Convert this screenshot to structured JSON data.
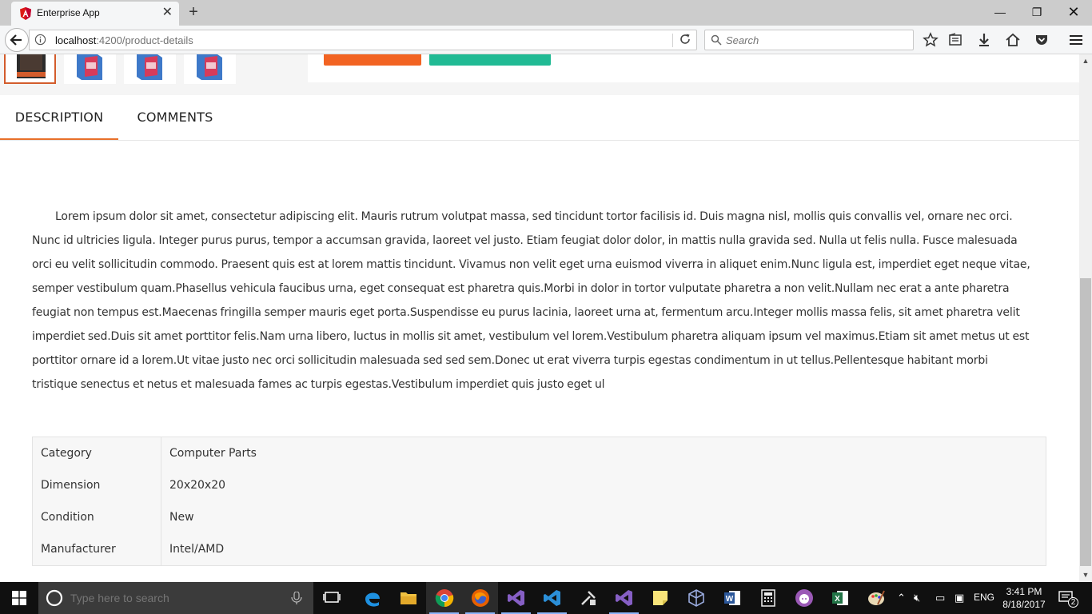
{
  "browser": {
    "tab_title": "Enterprise App",
    "url_host": "localhost",
    "url_path": ":4200/product-details",
    "search_placeholder": "Search"
  },
  "product": {
    "tabs": [
      {
        "label": "DESCRIPTION",
        "active": true
      },
      {
        "label": "COMMENTS",
        "active": false
      }
    ],
    "description": "Lorem ipsum dolor sit amet, consectetur adipiscing elit. Mauris rutrum volutpat massa, sed tincidunt tortor facilisis id. Duis magna nisl, mollis quis convallis vel, ornare nec orci. Nunc id ultricies ligula. Integer purus purus, tempor a accumsan gravida, laoreet vel justo. Etiam feugiat dolor dolor, in mattis nulla gravida sed. Nulla ut felis nulla. Fusce malesuada orci eu velit sollicitudin commodo. Praesent quis est at lorem mattis tincidunt. Vivamus non velit eget urna euismod viverra in aliquet enim.Nunc ligula est, imperdiet eget neque vitae, semper vestibulum quam.Phasellus vehicula faucibus urna, eget consequat est pharetra quis.Morbi in dolor in tortor vulputate pharetra a non velit.Nullam nec erat a ante pharetra feugiat non tempus est.Maecenas fringilla semper mauris eget porta.Suspendisse eu purus lacinia, laoreet urna at, fermentum arcu.Integer mollis massa felis, sit amet pharetra velit imperdiet sed.Duis sit amet porttitor felis.Nam urna libero, luctus in mollis sit amet, vestibulum vel lorem.Vestibulum pharetra aliquam ipsum vel maximus.Etiam sit amet metus ut est porttitor ornare id a lorem.Ut vitae justo nec orci sollicitudin malesuada sed sed sem.Donec ut erat viverra turpis egestas condimentum in ut tellus.Pellentesque habitant morbi tristique senectus et netus et malesuada fames ac turpis egestas.Vestibulum imperdiet quis justo eget ul",
    "specs": [
      {
        "key": "Category",
        "value": "Computer Parts"
      },
      {
        "key": "Dimension",
        "value": "20x20x20"
      },
      {
        "key": "Condition",
        "value": "New"
      },
      {
        "key": "Manufacturer",
        "value": "Intel/AMD"
      }
    ]
  },
  "taskbar": {
    "search_placeholder": "Type here to search",
    "language": "ENG",
    "time": "3:41 PM",
    "date": "8/18/2017",
    "notifications": "2"
  },
  "colors": {
    "accent_orange": "#f26322",
    "accent_teal": "#21ba94",
    "tab_underline": "#e8702a"
  }
}
